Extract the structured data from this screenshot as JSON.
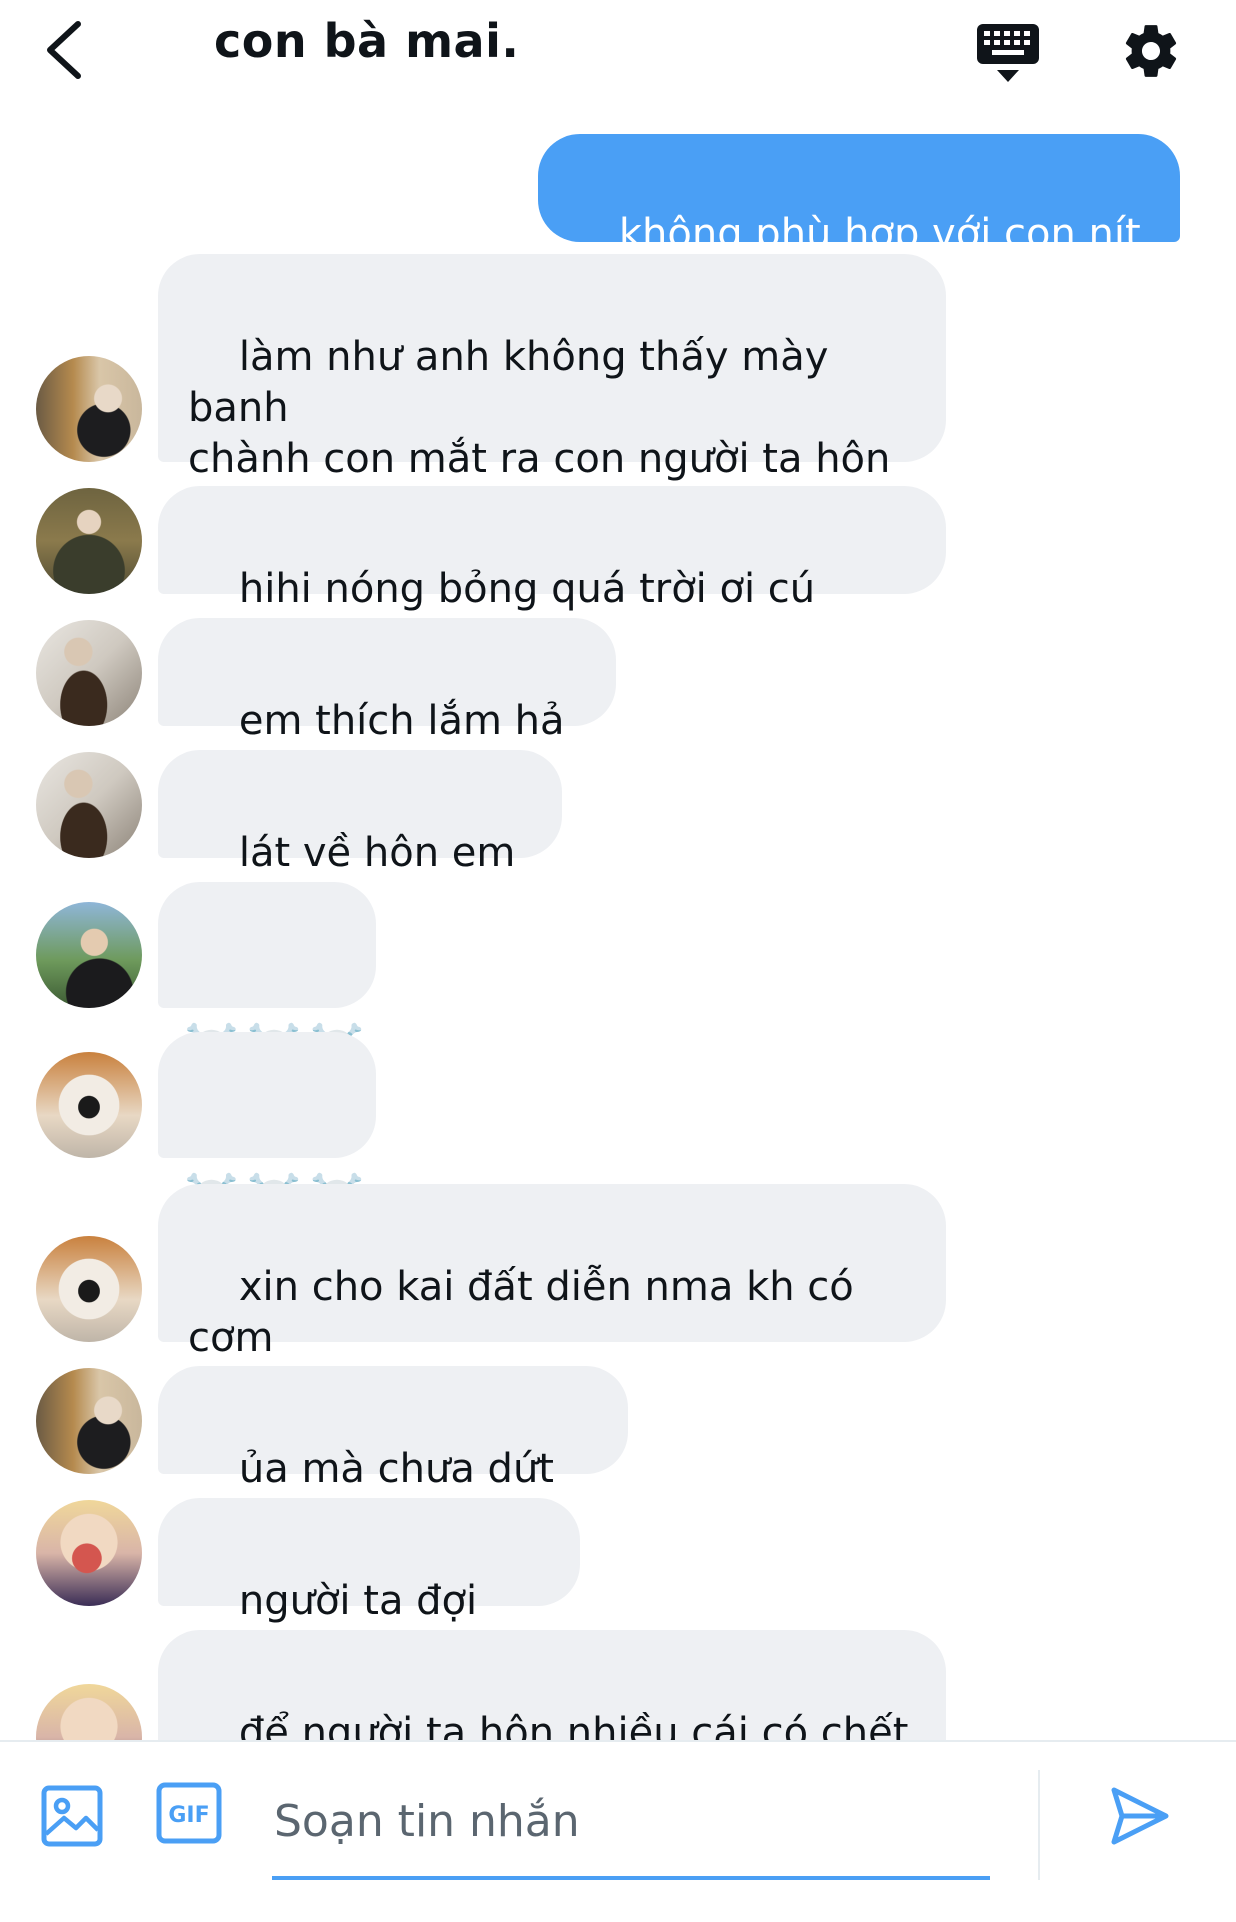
{
  "header": {
    "title": "con bà mai.",
    "back_icon": "chevron-left-icon",
    "keyboard_icon": "keyboard-icon",
    "settings_icon": "gear-icon"
  },
  "messages": [
    {
      "side": "out",
      "text": "không phù hợp với con nít đâu"
    },
    {
      "side": "in",
      "text": "làm như anh không thấy mày banh\nchành con mắt ra con người ta hôn\nnhau ?"
    },
    {
      "side": "in",
      "text": "hihi nóng bỏng quá trời ơi cú jungwon"
    },
    {
      "side": "in",
      "text": "em thích lắm hả bé ?"
    },
    {
      "side": "in",
      "text": "lát về hôn em nhé"
    },
    {
      "side": "in",
      "text": "☠️☠️☠️"
    },
    {
      "side": "in",
      "text": "☠️☠️☠️"
    },
    {
      "side": "in",
      "text": "xin cho kai đất diễn nma kh có cơm\ntró"
    },
    {
      "side": "in",
      "text": "ủa mà chưa dứt ra hả"
    },
    {
      "side": "in",
      "text": "người ta đợi lâu rồi"
    },
    {
      "side": "in",
      "text": "để người ta hôn nhiều cái có chết ai\nđâu"
    }
  ],
  "composer": {
    "placeholder": "Soạn tin nhắn",
    "gif_label": "GIF",
    "image_icon": "image-icon",
    "send_icon": "send-icon"
  },
  "colors": {
    "accent": "#4a9ff5",
    "incoming_bubble": "#eef0f3",
    "text": "#0f1419"
  }
}
